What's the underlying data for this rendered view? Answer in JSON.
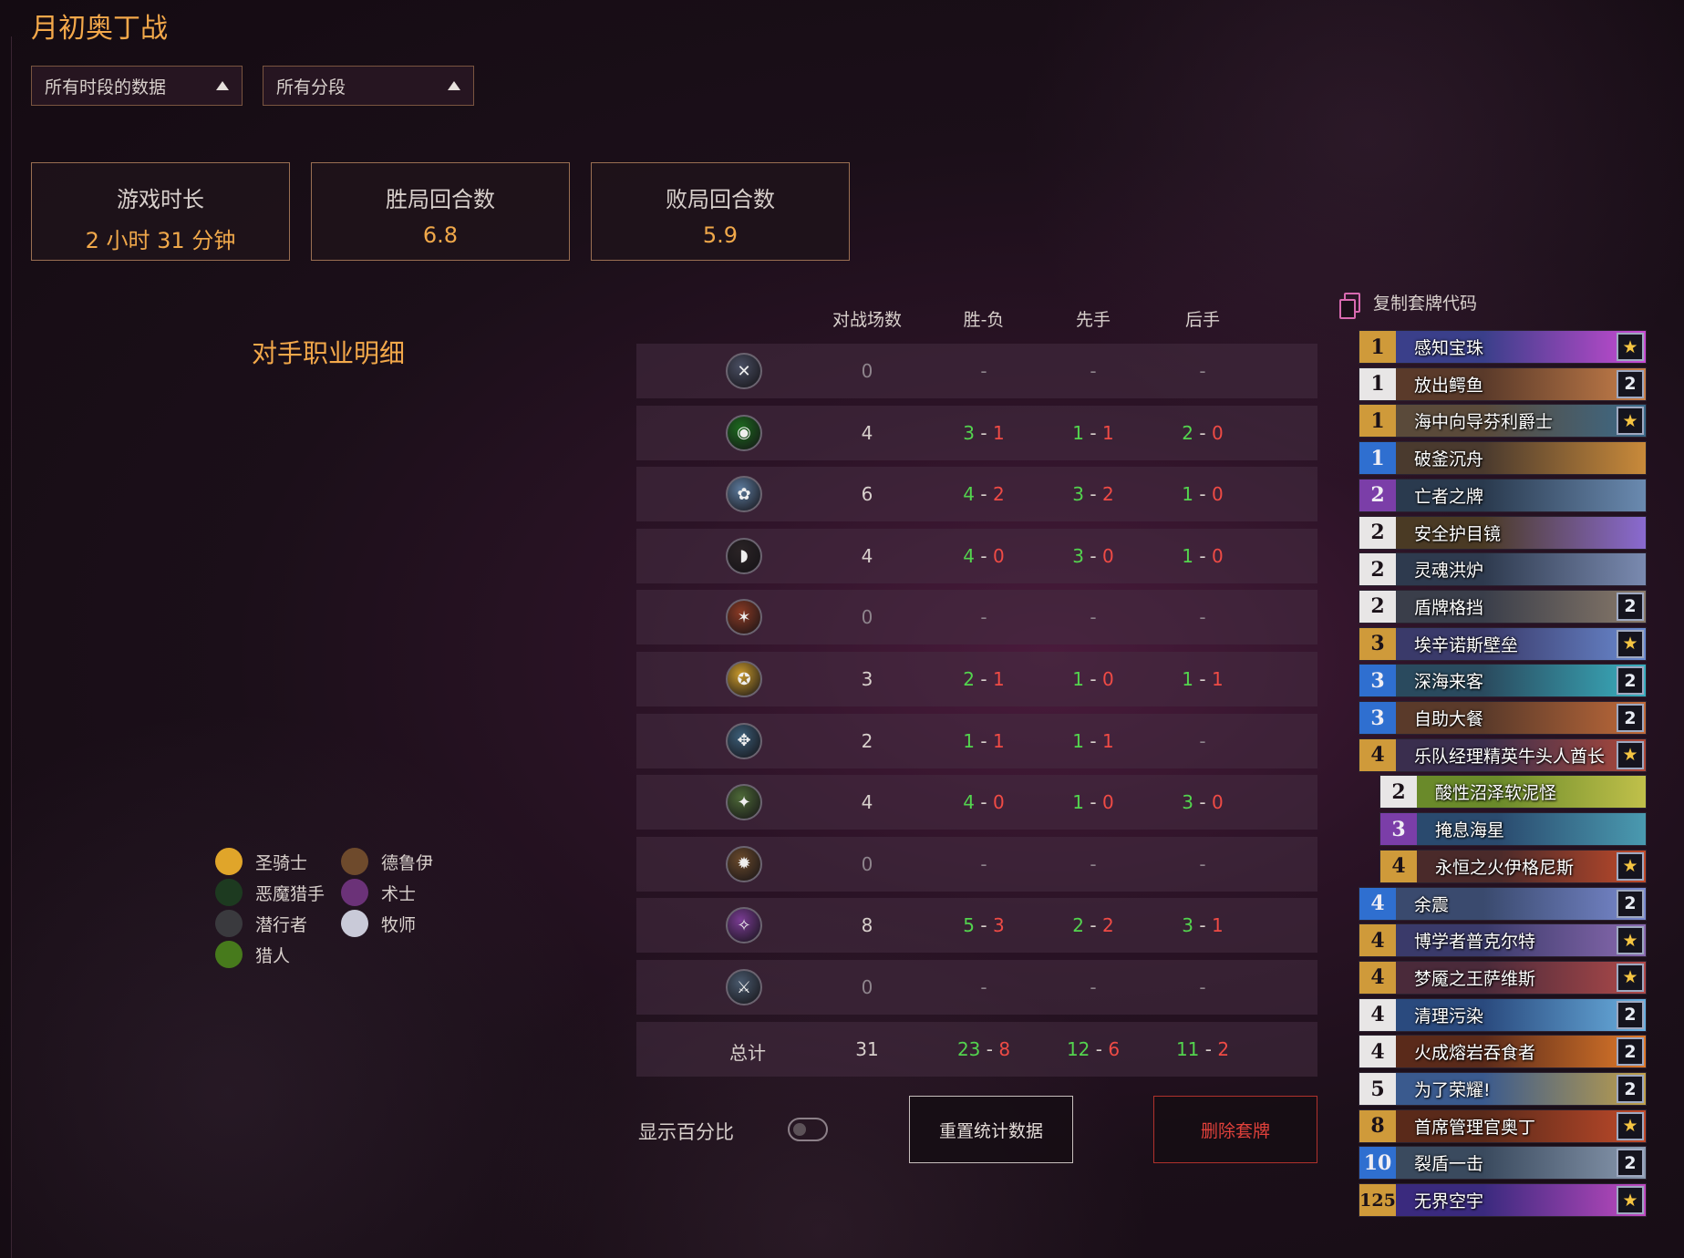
{
  "title": "月初奥丁战",
  "filters": {
    "period": "所有时段的数据",
    "rank": "所有分段"
  },
  "stats": [
    {
      "label": "游戏时长",
      "value": "2 小时 31 分钟"
    },
    {
      "label": "胜局回合数",
      "value": "6.8"
    },
    {
      "label": "败局回合数",
      "value": "5.9"
    }
  ],
  "section_title": "对手职业明细",
  "table": {
    "headers": [
      "对战场数",
      "胜-负",
      "先手",
      "后手"
    ],
    "rows": [
      {
        "icon": "class-icon-1",
        "games": "0",
        "wl": [
          "-",
          ""
        ],
        "first": [
          "-",
          ""
        ],
        "second": [
          "-",
          ""
        ]
      },
      {
        "icon": "class-icon-2",
        "games": "4",
        "wl": [
          "3",
          "1"
        ],
        "first": [
          "1",
          "1"
        ],
        "second": [
          "2",
          "0"
        ]
      },
      {
        "icon": "class-icon-3",
        "games": "6",
        "wl": [
          "4",
          "2"
        ],
        "first": [
          "3",
          "2"
        ],
        "second": [
          "1",
          "0"
        ]
      },
      {
        "icon": "class-icon-4",
        "games": "4",
        "wl": [
          "4",
          "0"
        ],
        "first": [
          "3",
          "0"
        ],
        "second": [
          "1",
          "0"
        ]
      },
      {
        "icon": "class-icon-5",
        "games": "0",
        "wl": [
          "-",
          ""
        ],
        "first": [
          "-",
          ""
        ],
        "second": [
          "-",
          ""
        ]
      },
      {
        "icon": "class-icon-6",
        "games": "3",
        "wl": [
          "2",
          "1"
        ],
        "first": [
          "1",
          "0"
        ],
        "second": [
          "1",
          "1"
        ]
      },
      {
        "icon": "class-icon-7",
        "games": "2",
        "wl": [
          "1",
          "1"
        ],
        "first": [
          "1",
          "1"
        ],
        "second": [
          "-",
          ""
        ]
      },
      {
        "icon": "class-icon-8",
        "games": "4",
        "wl": [
          "4",
          "0"
        ],
        "first": [
          "1",
          "0"
        ],
        "second": [
          "3",
          "0"
        ]
      },
      {
        "icon": "class-icon-9",
        "games": "0",
        "wl": [
          "-",
          ""
        ],
        "first": [
          "-",
          ""
        ],
        "second": [
          "-",
          ""
        ]
      },
      {
        "icon": "class-icon-10",
        "games": "8",
        "wl": [
          "5",
          "3"
        ],
        "first": [
          "2",
          "2"
        ],
        "second": [
          "3",
          "1"
        ]
      },
      {
        "icon": "class-icon-11",
        "games": "0",
        "wl": [
          "-",
          ""
        ],
        "first": [
          "-",
          ""
        ],
        "second": [
          "-",
          ""
        ]
      }
    ],
    "total": {
      "label": "总计",
      "games": "31",
      "wl": [
        "23",
        "8"
      ],
      "first": [
        "12",
        "6"
      ],
      "second": [
        "11",
        "2"
      ]
    }
  },
  "legend": [
    {
      "label": "圣骑士",
      "color": "#e0a52a"
    },
    {
      "label": "德鲁伊",
      "color": "#6e4a2c"
    },
    {
      "label": "恶魔猎手",
      "color": "#1d3a20"
    },
    {
      "label": "术士",
      "color": "#6b3278"
    },
    {
      "label": "潜行者",
      "color": "#3a3a3e"
    },
    {
      "label": "牧师",
      "color": "#c9cad8"
    },
    {
      "label": "猎人",
      "color": "#477a1c"
    }
  ],
  "controls": {
    "show_percent": "显示百分比",
    "reset": "重置统计数据",
    "delete": "删除套牌"
  },
  "copy_code": "复制套牌代码",
  "deck": [
    {
      "cost": "1",
      "name": "感知宝珠",
      "count": "★"
    },
    {
      "cost": "1",
      "name": "放出鳄鱼",
      "count": "2"
    },
    {
      "cost": "1",
      "name": "海中向导芬利爵士",
      "count": "★"
    },
    {
      "cost": "1",
      "name": "破釜沉舟",
      "count": ""
    },
    {
      "cost": "2",
      "name": "亡者之牌",
      "count": ""
    },
    {
      "cost": "2",
      "name": "安全护目镜",
      "count": ""
    },
    {
      "cost": "2",
      "name": "灵魂洪炉",
      "count": ""
    },
    {
      "cost": "2",
      "name": "盾牌格挡",
      "count": "2"
    },
    {
      "cost": "3",
      "name": "埃辛诺斯壁垒",
      "count": "★"
    },
    {
      "cost": "3",
      "name": "深海来客",
      "count": "2"
    },
    {
      "cost": "3",
      "name": "自助大餐",
      "count": "2"
    },
    {
      "cost": "4",
      "name": "乐队经理精英牛头人酋长",
      "count": "★"
    },
    {
      "cost": "2",
      "name": "酸性沼泽软泥怪",
      "count": ""
    },
    {
      "cost": "3",
      "name": "掩息海星",
      "count": ""
    },
    {
      "cost": "4",
      "name": "永恒之火伊格尼斯",
      "count": "★"
    },
    {
      "cost": "4",
      "name": "余震",
      "count": "2"
    },
    {
      "cost": "4",
      "name": "博学者普克尔特",
      "count": "★"
    },
    {
      "cost": "4",
      "name": "梦魇之王萨维斯",
      "count": "★"
    },
    {
      "cost": "4",
      "name": "清理污染",
      "count": "2"
    },
    {
      "cost": "4",
      "name": "火成熔岩吞食者",
      "count": "2"
    },
    {
      "cost": "5",
      "name": "为了荣耀!",
      "count": "2"
    },
    {
      "cost": "8",
      "name": "首席管理官奥丁",
      "count": "★"
    },
    {
      "cost": "10",
      "name": "裂盾一击",
      "count": "2"
    },
    {
      "cost": "125",
      "name": "无界空宇",
      "count": "★"
    }
  ]
}
